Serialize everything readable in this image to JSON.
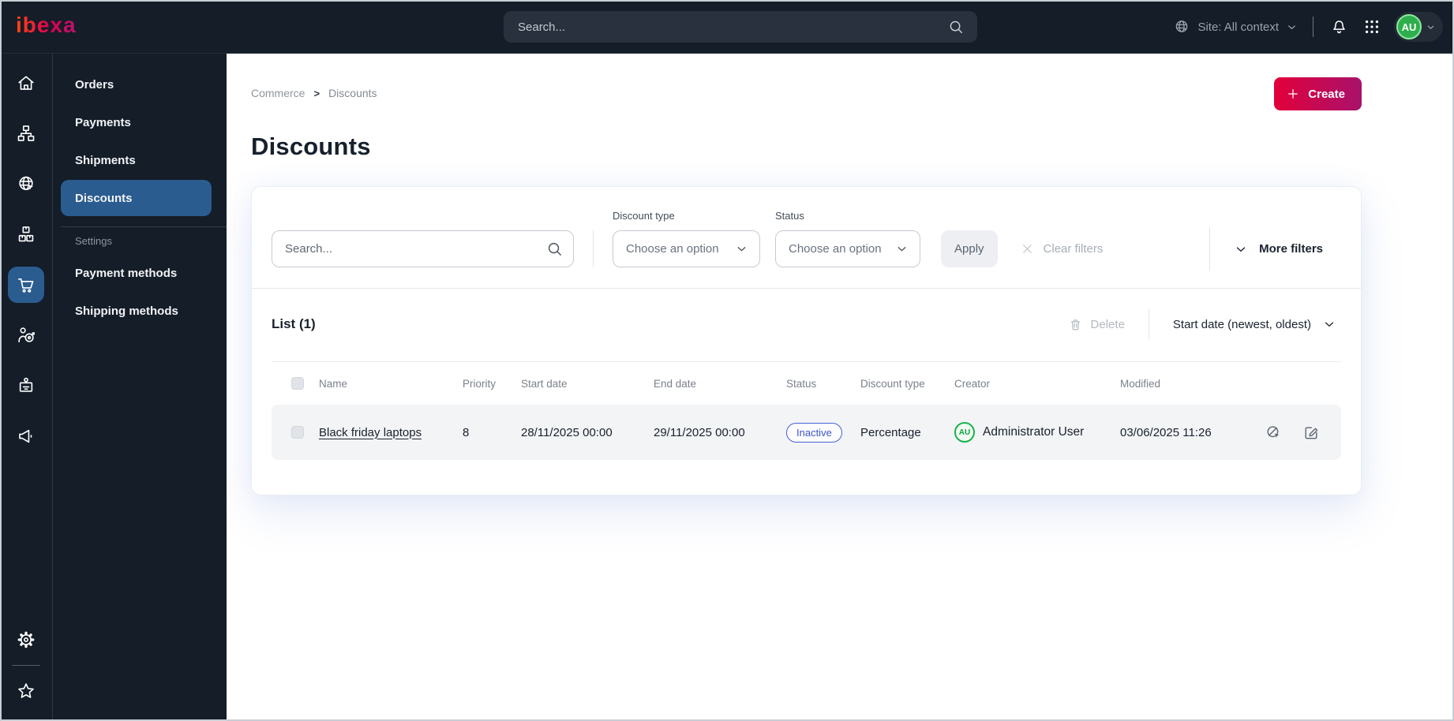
{
  "topbar": {
    "logo": "ibexa",
    "search_placeholder": "Search...",
    "site_context": "Site: All context",
    "avatar_initials": "AU"
  },
  "sidebar": {
    "icons": [
      "home",
      "site-structure",
      "site",
      "products",
      "commerce",
      "customers",
      "corporate",
      "marketing"
    ],
    "active_icon": "commerce",
    "bottom_icons": [
      "settings",
      "bookmarks"
    ]
  },
  "menu": {
    "items": [
      "Orders",
      "Payments",
      "Shipments",
      "Discounts"
    ],
    "active_item": "Discounts",
    "section_label": "Settings",
    "settings_items": [
      "Payment methods",
      "Shipping methods"
    ]
  },
  "breadcrumb": {
    "items": [
      "Commerce",
      "Discounts"
    ],
    "separator": ">"
  },
  "page": {
    "title": "Discounts",
    "create_label": "Create"
  },
  "filters": {
    "search_placeholder": "Search...",
    "discount_type_label": "Discount type",
    "discount_type_value": "Choose an option",
    "status_label": "Status",
    "status_value": "Choose an option",
    "apply_label": "Apply",
    "clear_label": "Clear filters",
    "more_label": "More filters"
  },
  "list": {
    "title": "List (1)",
    "delete_label": "Delete",
    "sort_label": "Start date (newest, oldest)",
    "columns": [
      "Name",
      "Priority",
      "Start date",
      "End date",
      "Status",
      "Discount type",
      "Creator",
      "Modified"
    ],
    "rows": [
      {
        "name": "Black friday laptops",
        "priority": "8",
        "start_date": "28/11/2025 00:00",
        "end_date": "29/11/2025 00:00",
        "status": "Inactive",
        "discount_type": "Percentage",
        "creator_initials": "AU",
        "creator": "Administrator User",
        "modified": "03/06/2025 11:26"
      }
    ]
  },
  "icons": {
    "topbar": [
      "globe-icon",
      "chevron-down-icon",
      "bell-icon",
      "apps-grid-icon",
      "search-icon"
    ],
    "rail": [
      "home-icon",
      "site-structure-icon",
      "globe-cursor-icon",
      "boxes-icon",
      "cart-icon",
      "customer-target-icon",
      "id-badge-icon",
      "megaphone-icon",
      "gear-icon",
      "star-icon"
    ],
    "list": [
      "trash-icon",
      "clear-x-icon",
      "preview-disabled-icon",
      "edit-icon",
      "plus-icon",
      "magnifier-icon"
    ]
  },
  "colors": {
    "topbar_bg": "#141d28",
    "active_blue": "#2b5c8f",
    "brand_gradient": [
      "#ff4713",
      "#b5156b"
    ],
    "create_gradient": [
      "#e3003c",
      "#a8126b"
    ],
    "badge_blue": "#4560d6",
    "avatar_green": "#17b34a",
    "row_bg": "#f3f4f6"
  }
}
